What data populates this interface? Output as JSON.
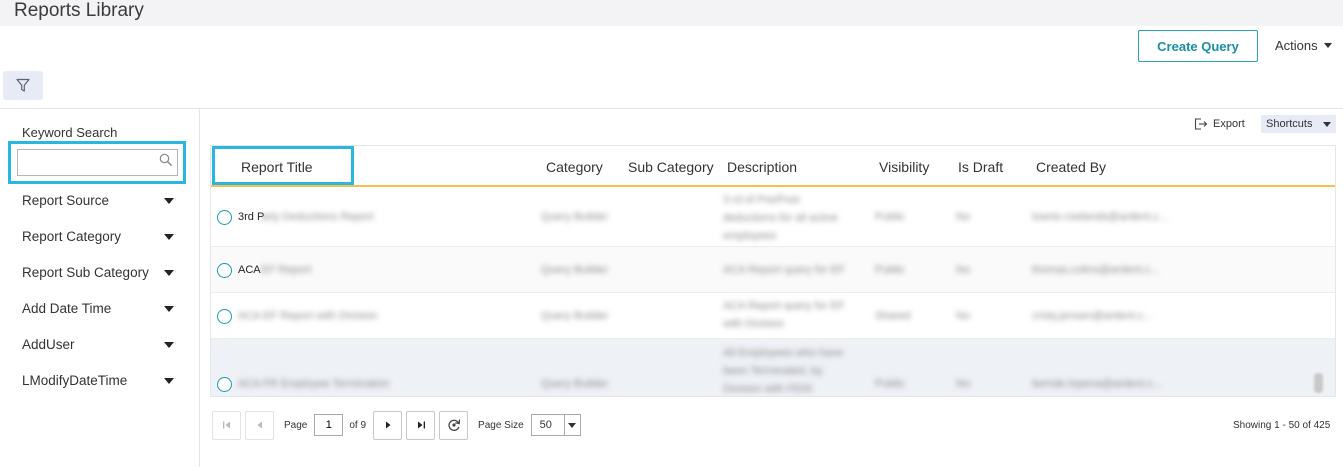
{
  "header": {
    "title": "Reports Library",
    "create_query_label": "Create Query",
    "actions_label": "Actions"
  },
  "sidebar": {
    "keyword_label": "Keyword Search",
    "keyword_value": "",
    "facets": [
      "Report Source",
      "Report Category",
      "Report Sub Category",
      "Add Date Time",
      "AddUser",
      "LModifyDateTime"
    ]
  },
  "toolbar": {
    "export_label": "Export",
    "shortcuts_label": "Shortcuts"
  },
  "grid": {
    "columns": [
      "Report Title",
      "Category",
      "Sub Category",
      "Description",
      "Visibility",
      "Is Draft",
      "Created By"
    ],
    "rows": [
      {
        "title_prefix": "3rd P",
        "title_rest": "arty Deductions Report",
        "category": "Query Builder",
        "description": [
          "3 rd of Pre/Post",
          "deductions for all active",
          "employees"
        ],
        "visibility": "Public",
        "is_draft": "No",
        "created_by": "lowrie.rowlands@ardent.c..."
      },
      {
        "title_prefix": "ACA",
        "title_rest": " EF Report",
        "category": "Query Builder",
        "description": [
          "ACA Report query for EF"
        ],
        "visibility": "Public",
        "is_draft": "No",
        "created_by": "thomas.colins@ardent.c..."
      },
      {
        "title_prefix": "",
        "title_rest": "ACA EF Report with Division",
        "category": "Query Builder",
        "description": [
          "ACA Report query for EF",
          "with Division"
        ],
        "visibility": "Shared",
        "is_draft": "No",
        "created_by": "cristy.jensen@ardent.c..."
      },
      {
        "title_prefix": "",
        "title_rest": "ACA FR Employee Termination",
        "category": "Query Builder",
        "description": [
          "All Employees who have",
          "been Terminated, by",
          "Division with FEIN"
        ],
        "visibility": "Public",
        "is_draft": "No",
        "created_by": "bemde.lopena@ardent.c..."
      }
    ]
  },
  "pager": {
    "page_label": "Page",
    "page_value": "1",
    "of_label": "of 9",
    "page_size_label": "Page Size",
    "page_size_value": "50",
    "showing_text": "Showing 1 - 50 of 425"
  },
  "colors": {
    "accent": "#1a8fa3",
    "highlight": "#29b6e0",
    "header_rule": "#f3c24b",
    "chip_bg": "#e6ebf5"
  },
  "icons": [
    "funnel-icon",
    "search-icon",
    "export-icon",
    "refresh-icon",
    "first-page-icon",
    "prev-page-icon",
    "next-page-icon",
    "last-page-icon"
  ]
}
